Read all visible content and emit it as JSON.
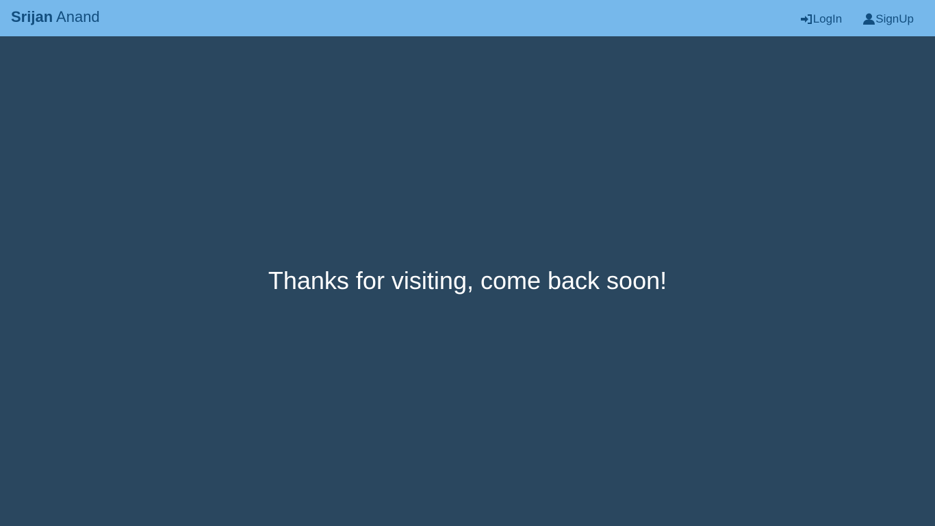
{
  "navbar": {
    "brand_first": "Srijan",
    "brand_last": "Anand",
    "links": [
      {
        "label": "LogIn",
        "icon": "sign-in-icon"
      },
      {
        "label": "SignUp",
        "icon": "user-icon"
      }
    ]
  },
  "main": {
    "message": "Thanks for visiting, come back soon!"
  },
  "colors": {
    "navbar_bg": "#76b8eb",
    "page_bg": "#2a475f",
    "nav_text": "#124e7f",
    "message_text": "#ffffff"
  }
}
